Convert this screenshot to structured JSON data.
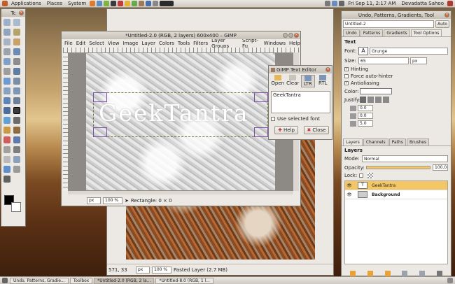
{
  "colors": {
    "accent": "#f3c766",
    "close_red": "#d85a2a"
  },
  "top_panel": {
    "menus": [
      "Applications",
      "Places",
      "System"
    ],
    "datetime": "Fri Sep 11,  2:17 AM",
    "user": "Devadatta Sahoo"
  },
  "taskbar": {
    "items": [
      "Undo, Patterns, Gradie...",
      "Toolbox",
      "*Untitled-2.0 (RGB, 2 la...",
      "*Untitled-8.0 (RGB, 1 l..."
    ]
  },
  "toolbox": {
    "title": "Tc"
  },
  "image_window": {
    "title": "*Untitled-2.0 (RGB, 2 layers) 600x400 – GIMP",
    "menu": [
      "File",
      "Edit",
      "Select",
      "View",
      "Image",
      "Layer",
      "Colors",
      "Tools",
      "Filters",
      "Layer Groups",
      "Script-Fu",
      "Windows",
      "Help"
    ],
    "canvas_text": "GeekTantra",
    "status": {
      "unit": "px",
      "zoom": "100 %",
      "message": "Rectangle: 0 × 0"
    }
  },
  "back_window": {
    "status": {
      "coords": "571, 33",
      "unit": "px",
      "zoom": "100 %",
      "message": "Pasted Layer (2.7 MB)"
    }
  },
  "text_editor": {
    "title": "GIMP Text Editor",
    "buttons": {
      "open": "Open",
      "clear": "Clear",
      "ltr": "LTR",
      "rtl": "RTL"
    },
    "text": "GeekTantra",
    "use_selected_font": "Use selected font",
    "help": "Help",
    "close": "Close"
  },
  "dock": {
    "title": "Undo, Patterns, Gradients, Tool",
    "image_select": "Untitled-2",
    "auto": "Auto",
    "tabs": [
      "Undo",
      "Patterns",
      "Gradients",
      "Tool Options"
    ],
    "section": "Text",
    "font_label": "Font:",
    "font_value": "Grunge",
    "size_label": "Size:",
    "size_value": "65",
    "size_unit": "px",
    "hinting": "Hinting",
    "force_autohinter": "Force auto-hinter",
    "antialiasing": "Antialiasing",
    "color_label": "Color:",
    "justify_label": "Justify:",
    "indent_value": "0.0",
    "line_spacing_value": "0.0",
    "letter_spacing_value": "5.0",
    "layer_tabs": [
      "Layers",
      "Channels",
      "Paths",
      "Brushes"
    ],
    "layers_header": "Layers",
    "mode_label": "Mode:",
    "mode_value": "Normal",
    "opacity_label": "Opacity:",
    "opacity_value": "100.0",
    "opacity_fraction": 1.0,
    "lock_label": "Lock:",
    "layers": [
      "GeekTantra",
      "Background"
    ]
  }
}
